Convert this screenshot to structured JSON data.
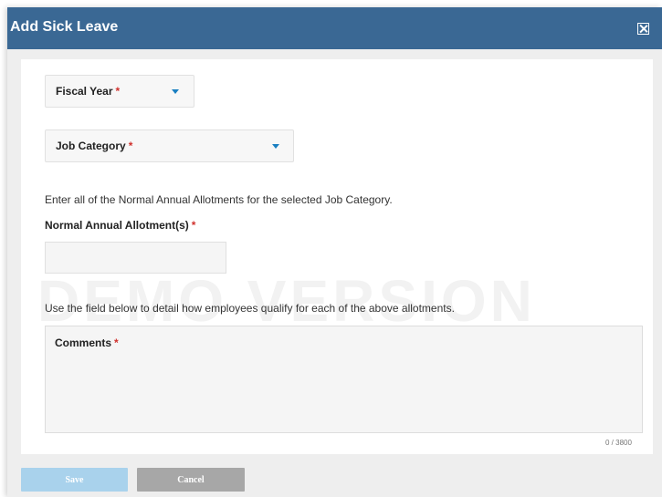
{
  "dialog": {
    "title": "Add Sick Leave",
    "close_icon": "close-x-icon"
  },
  "form": {
    "fiscal_year": {
      "label": "Fiscal Year",
      "required_mark": "*",
      "value": ""
    },
    "job_category": {
      "label": "Job Category",
      "required_mark": "*",
      "value": ""
    },
    "allotment_instructions": "Enter all of the Normal Annual Allotments for the selected Job Category.",
    "allotment_label": "Normal Annual Allotment(s)",
    "allotment_required_mark": "*",
    "watermark": "DEMO VERSION",
    "comments_instructions": "Use the field below to detail how employees qualify for each of the above allotments.",
    "comments_label": "Comments",
    "comments_required_mark": "*",
    "char_counter": "0 / 3800"
  },
  "actions": {
    "save_label": "Save",
    "cancel_label": "Cancel"
  },
  "colors": {
    "header": "#3a6894",
    "required": "#d0312d",
    "caret": "#1a7fc1",
    "save_button": "#a9d2ec",
    "cancel_button": "#a7a7a7"
  }
}
